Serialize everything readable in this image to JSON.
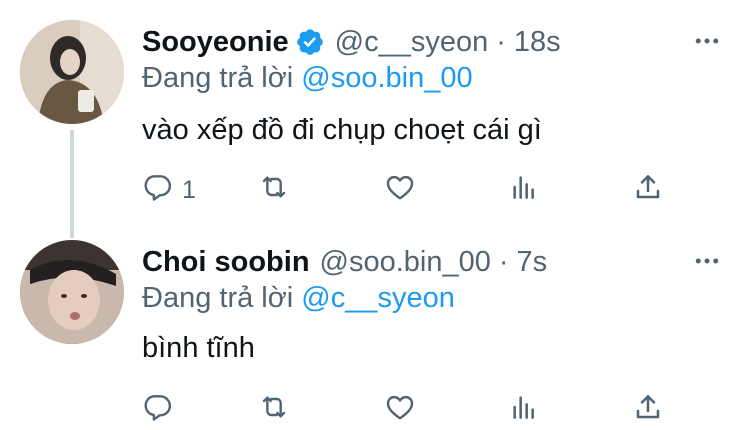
{
  "tweets": [
    {
      "display_name": "Sooyeonie",
      "verified": true,
      "handle": "@c__syeon",
      "separator": "·",
      "time": "18s",
      "replying_prefix": "Đang trả lời",
      "replying_to": "@soo.bin_00",
      "text": "vào xếp đồ đi chụp choẹt cái gì",
      "reply_count": "1"
    },
    {
      "display_name": "Choi soobin",
      "verified": false,
      "handle": "@soo.bin_00",
      "separator": "·",
      "time": "7s",
      "replying_prefix": "Đang trả lời",
      "replying_to": "@c__syeon",
      "text": "bình tĩnh",
      "reply_count": ""
    }
  ],
  "colors": {
    "text_primary": "#0f1419",
    "text_secondary": "#536471",
    "accent": "#1d9bf0",
    "thread_line": "#cfd9de"
  },
  "icons": [
    "more-icon",
    "verified-badge-icon",
    "reply-icon",
    "retweet-icon",
    "like-icon",
    "stats-icon",
    "share-icon"
  ]
}
